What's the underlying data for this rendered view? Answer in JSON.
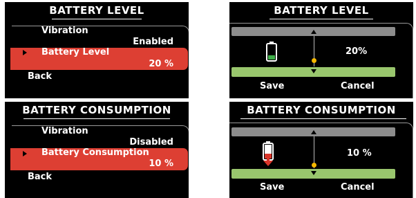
{
  "panels": [
    {
      "title": "BATTERY LEVEL",
      "menu": {
        "vibration_label": "Vibration",
        "vibration_value": "Enabled",
        "selected_label": "Battery Level",
        "selected_value": "20 %",
        "back_label": "Back"
      }
    },
    {
      "title": "BATTERY LEVEL",
      "slider": {
        "value_text": "20%",
        "level": 0.2,
        "save_label": "Save",
        "cancel_label": "Cancel"
      }
    },
    {
      "title": "BATTERY CONSUMPTION",
      "menu": {
        "vibration_label": "Vibration",
        "vibration_value": "Disabled",
        "selected_label": "Battery Consumption",
        "selected_value": "10 %",
        "back_label": "Back"
      }
    },
    {
      "title": "BATTERY CONSUMPTION",
      "slider": {
        "value_text": "10 %",
        "level": 0.1,
        "save_label": "Save",
        "cancel_label": "Cancel"
      }
    }
  ],
  "colors": {
    "highlight": "#dd3f33",
    "slider_top": "#8c8c8c",
    "slider_bottom": "#99c66d",
    "knob": "#f5b800",
    "battery_fill": "#3fae49",
    "consumption_arrow": "#d9362b"
  },
  "icons": {
    "battery_level": "battery-icon",
    "battery_consumption": "battery-drain-icon"
  }
}
